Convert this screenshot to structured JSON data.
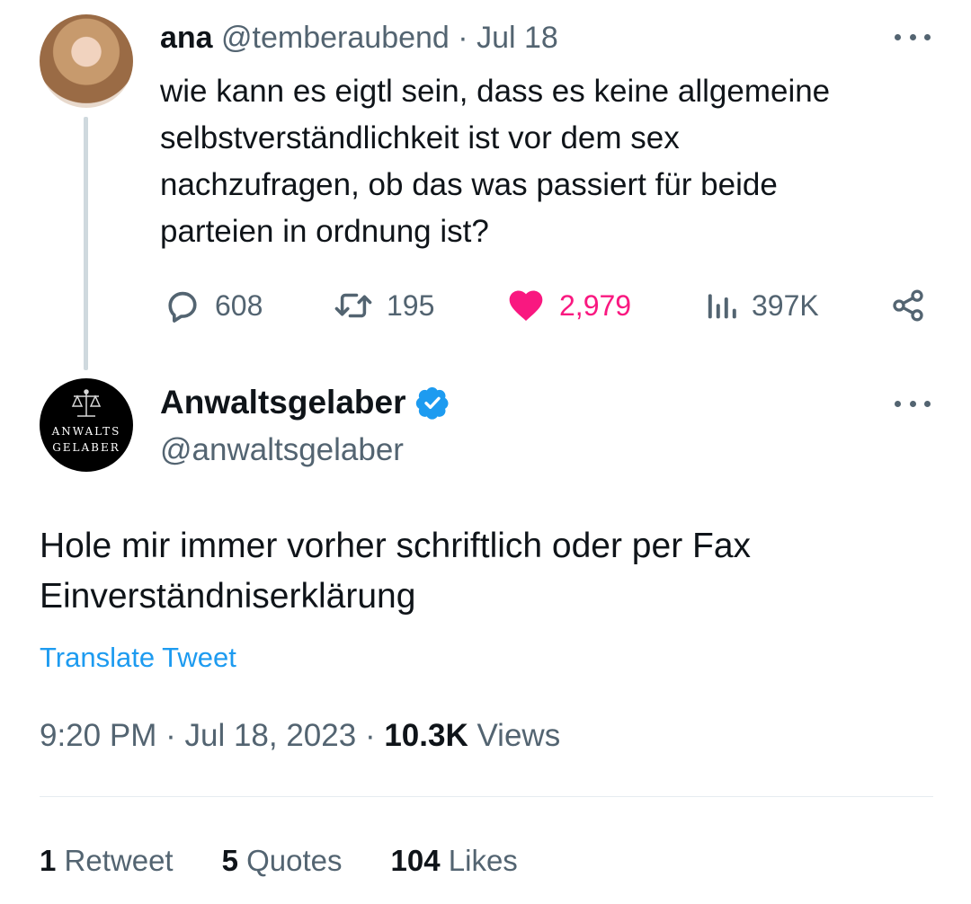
{
  "parent_tweet": {
    "author_name": "ana",
    "handle": "@temberaubend",
    "separator": "·",
    "date": "Jul 18",
    "text": "wie kann es eigtl sein, dass es keine allgemeine\nselbstverständlichkeit ist vor dem sex\nnachzufragen, ob das was passiert für beide\nparteien in ordnung ist?",
    "replies": "608",
    "retweets": "195",
    "likes": "2,979",
    "views": "397K",
    "icons": [
      "reply-icon",
      "retweet-icon",
      "heart-icon",
      "views-icon",
      "share-icon",
      "more-icon"
    ]
  },
  "main_tweet": {
    "author_name": "Anwaltsgelaber",
    "handle": "@anwaltsgelaber",
    "avatar_text_line1": "ANWALTS",
    "avatar_text_line2": "GELABER",
    "text": "Hole mir immer vorher schriftlich oder per Fax\nEinverständniserklärung",
    "translate_label": "Translate Tweet",
    "time": "9:20 PM",
    "separator": "·",
    "date": "Jul 18, 2023",
    "views_count": "10.3K",
    "views_label": "Views",
    "retweets_count": "1",
    "retweets_label": "Retweet",
    "quotes_count": "5",
    "quotes_label": "Quotes",
    "likes_count": "104",
    "likes_label": "Likes"
  },
  "colors": {
    "text": "#0f1419",
    "muted": "#536471",
    "link": "#1d9bf0",
    "like": "#f91880",
    "verified": "#1d9bf0",
    "thread_line": "#cfd9de"
  }
}
